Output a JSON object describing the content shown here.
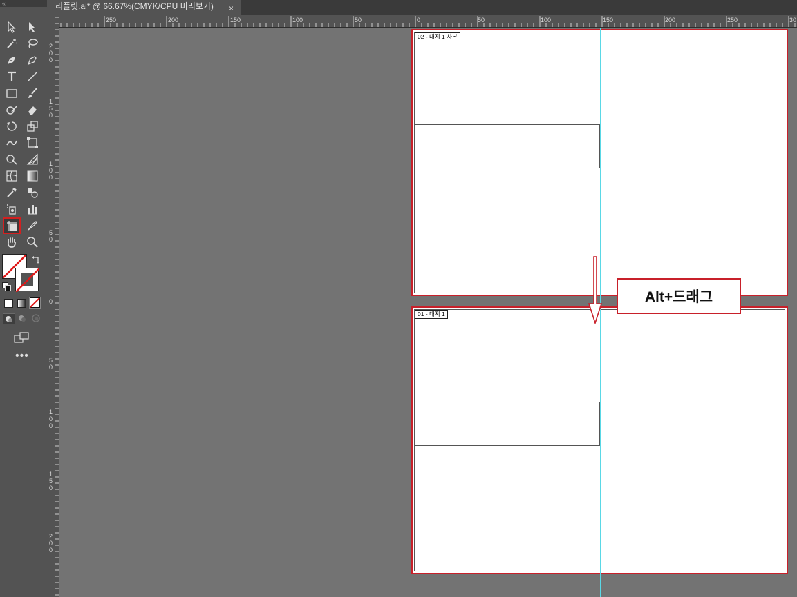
{
  "window": {
    "menu_grip": "«"
  },
  "tab": {
    "title": "리플릿.ai* @ 66.67%(CMYK/CPU 미리보기)",
    "close": "×"
  },
  "hruler": {
    "labels": [
      "250",
      "200",
      "150",
      "100",
      "50",
      "0",
      "50",
      "100",
      "150",
      "200",
      "250",
      "30"
    ]
  },
  "vruler": {
    "labels": [
      "2\n0\n0",
      "1\n5\n0",
      "1\n0\n0",
      "5\n0",
      "0",
      "5\n0",
      "1\n0\n0",
      "1\n5\n0",
      "2\n0\n0"
    ]
  },
  "artboards": [
    {
      "label": "02 - 대지 1 사본"
    },
    {
      "label": "01 - 대지 1"
    }
  ],
  "callout": {
    "text": "Alt+드래그"
  },
  "colors": {
    "accent_red": "#c8202a",
    "guide": "#5ad8e6",
    "canvas": "#737373",
    "panel": "#535353"
  },
  "tools": [
    "selection-tool",
    "direct-selection-tool",
    "magic-wand-tool",
    "lasso-tool",
    "pen-tool",
    "curvature-tool",
    "type-tool",
    "line-tool",
    "rectangle-tool",
    "paintbrush-tool",
    "shaper-tool",
    "eraser-tool",
    "rotate-tool",
    "scale-tool",
    "warp-tool",
    "free-transform-tool",
    "shape-builder-tool",
    "perspective-grid-tool",
    "mesh-tool",
    "gradient-tool",
    "eyedropper-tool",
    "blend-tool",
    "symbol-sprayer-tool",
    "column-graph-tool",
    "artboard-tool",
    "slice-tool",
    "hand-tool",
    "zoom-tool"
  ]
}
